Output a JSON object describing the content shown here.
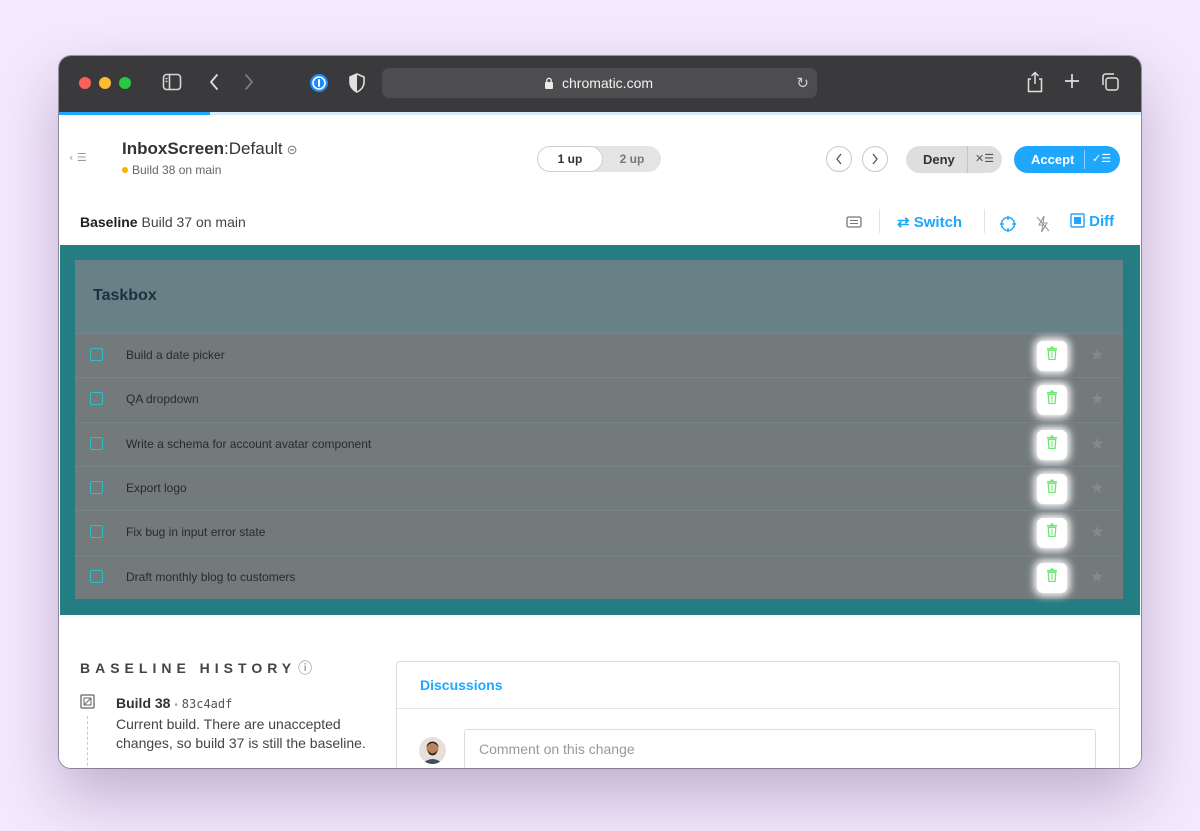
{
  "browser": {
    "url": "chromatic.com",
    "lock_icon": "lock-icon",
    "progress_percent": 14,
    "toolbar_icons": [
      "sidebar-icon",
      "back-icon",
      "forward-icon",
      "password-manager-icon",
      "shield-icon",
      "reload-icon",
      "share-icon",
      "new-tab-icon",
      "tabs-icon"
    ]
  },
  "header": {
    "component": "InboxScreen",
    "separator": ":",
    "story": "Default",
    "build_status": "Build 38 on main",
    "status_color": "#ffae00",
    "view_modes": [
      "1 up",
      "2 up"
    ],
    "active_view": "1 up",
    "deny_label": "Deny",
    "accept_label": "Accept",
    "accent": "#1ea7fd"
  },
  "baseline": {
    "label": "Baseline",
    "value": "Build 37 on main",
    "switch_label": "Switch",
    "diff_label": "Diff"
  },
  "snapshot": {
    "app_title": "Taskbox",
    "tasks": [
      "Build a date picker",
      "QA dropdown",
      "Write a schema for account avatar component",
      "Export logo",
      "Fix bug in input error state",
      "Draft monthly blog to customers"
    ],
    "diff_highlight_color": "#6ee672",
    "frame_color": "#237d83"
  },
  "history": {
    "title": "BASELINE HISTORY",
    "build": "Build 38",
    "sha": "83c4adf",
    "description": "Current build. There are unaccepted changes, so build 37 is still the baseline."
  },
  "discussions": {
    "title": "Discussions",
    "placeholder": "Comment on this change"
  }
}
